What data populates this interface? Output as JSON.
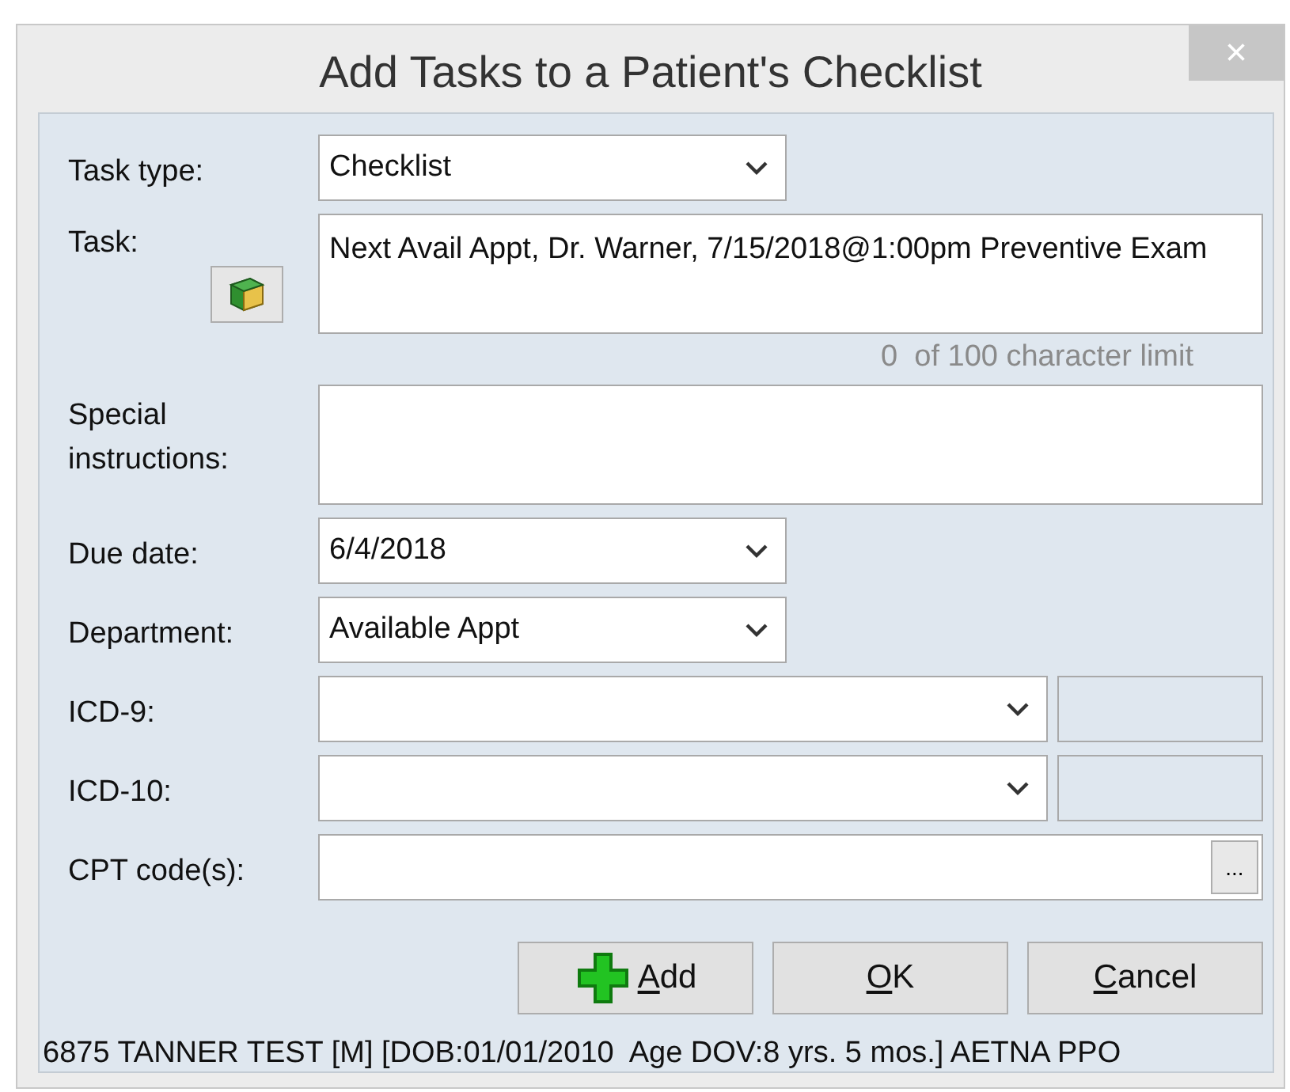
{
  "window": {
    "title": "Add Tasks to a Patient's Checklist",
    "close": "×"
  },
  "form": {
    "task_type": {
      "label": "Task type:",
      "value": "Checklist"
    },
    "task": {
      "label": "Task:",
      "value": "Next Avail Appt, Dr. Warner, 7/15/2018@1:00pm Preventive Exam",
      "limit_note": "0  of 100 character limit"
    },
    "special_instructions": {
      "label": "Special instructions:"
    },
    "due_date": {
      "label": "Due date:",
      "value": "6/4/2018"
    },
    "department": {
      "label": "Department:",
      "value": "Available Appt"
    },
    "icd9": {
      "label": "ICD-9:"
    },
    "icd10": {
      "label": "ICD-10:"
    },
    "cpt": {
      "label": "CPT code(s):",
      "browse": "..."
    }
  },
  "buttons": [
    {
      "label": "Add",
      "kind": "add"
    },
    {
      "label": "OK",
      "kind": "plain"
    },
    {
      "label": "Cancel",
      "kind": "plain"
    }
  ],
  "status_bar": "6875 TANNER TEST [M] [DOB:01/01/2010  Age DOV:8 yrs. 5 mos.] AETNA PPO"
}
